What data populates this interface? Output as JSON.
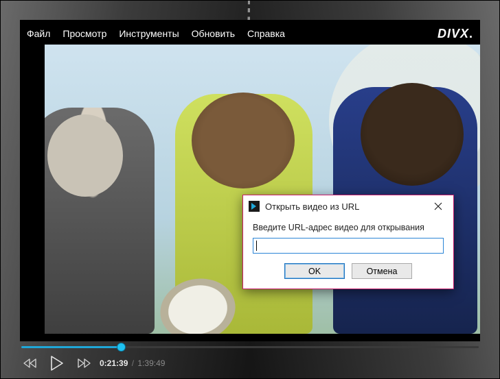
{
  "menu": {
    "file": "Файл",
    "view": "Просмотр",
    "tools": "Инструменты",
    "update": "Обновить",
    "help": "Справка"
  },
  "brand": "DIVX",
  "playback": {
    "current": "0:21:39",
    "total": "1:39:49",
    "progress_percent": 21.7
  },
  "dialog": {
    "title": "Открыть видео из URL",
    "prompt": "Введите URL-адрес видео для открывания",
    "value": "",
    "placeholder": "",
    "ok": "OK",
    "cancel": "Отмена"
  }
}
